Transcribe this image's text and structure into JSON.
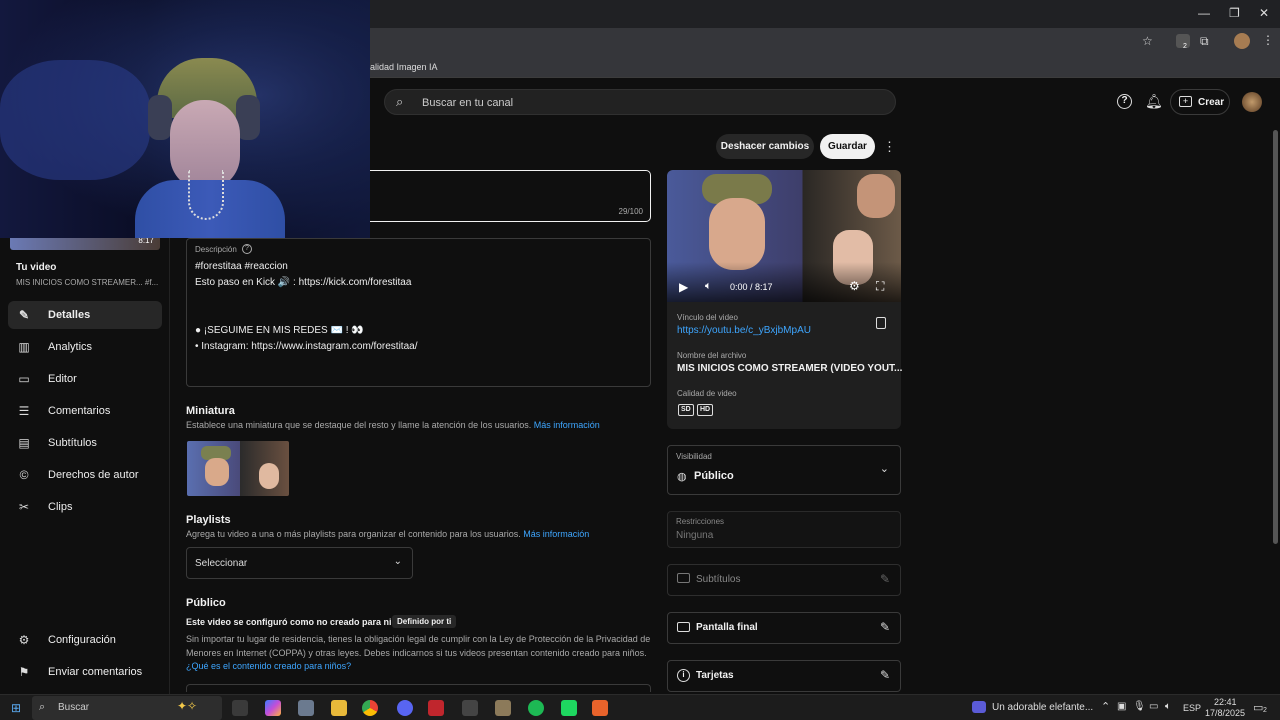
{
  "browser": {
    "bookmark_text": "alidad Imagen IA",
    "ext_badge": "2"
  },
  "header": {
    "search_placeholder": "Buscar en tu canal",
    "create_label": "Crear"
  },
  "sidebar": {
    "video_time": "8:17",
    "your_video_label": "Tu video",
    "video_title": "MIS INICIOS COMO STREAMER... #f...",
    "items": [
      {
        "label": "Detalles",
        "icon": "pencil-icon"
      },
      {
        "label": "Analytics",
        "icon": "analytics-icon"
      },
      {
        "label": "Editor",
        "icon": "editor-icon"
      },
      {
        "label": "Comentarios",
        "icon": "comments-icon"
      },
      {
        "label": "Subtítulos",
        "icon": "subtitles-icon"
      },
      {
        "label": "Derechos de autor",
        "icon": "copyright-icon"
      },
      {
        "label": "Clips",
        "icon": "scissors-icon"
      }
    ],
    "bottom": [
      {
        "label": "Configuración",
        "icon": "gear-icon"
      },
      {
        "label": "Enviar comentarios",
        "icon": "feedback-icon"
      }
    ]
  },
  "toolbar": {
    "undo_label": "Deshacer cambios",
    "save_label": "Guardar"
  },
  "title_field": {
    "counter": "29/100"
  },
  "description": {
    "label": "Descripción",
    "lines": [
      "#forestitaa #reaccion",
      "Esto paso en Kick 🔊 : https://kick.com/forestitaa",
      "",
      "",
      "● ¡SEGUIME EN MIS REDES ✉️ ! 👀",
      "• Instagram: https://www.instagram.com/forestitaa/"
    ]
  },
  "thumbnail": {
    "title": "Miniatura",
    "hint": "Establece una miniatura que se destaque del resto y llame la atención de los usuarios.",
    "link": "Más información"
  },
  "playlists": {
    "title": "Playlists",
    "hint": "Agrega tu video a una o más playlists para organizar el contenido para los usuarios.",
    "link": "Más información",
    "select_value": "Seleccionar"
  },
  "audience": {
    "title": "Público",
    "status": "Este video se configuró como no creado para niños",
    "badge": "Definido por ti",
    "legal": "Sin importar tu lugar de residencia, tienes la obligación legal de cumplir con la Ley de Protección de la Privacidad de Menores en Internet (COPPA) y otras leyes. Debes indicarnos si tus videos presentan contenido creado para niños.",
    "legal_link": "¿Qué es el contenido creado para niños?"
  },
  "player": {
    "time": "0:00 / 8:17",
    "link_label": "Vínculo del video",
    "link": "https://youtu.be/c_yBxjbMpAU",
    "file_label": "Nombre del archivo",
    "file_name": "MIS INICIOS COMO STREAMER (VIDEO YOUT...",
    "quality_label": "Calidad de video",
    "quality_badges": [
      "SD",
      "HD"
    ]
  },
  "visibility": {
    "label": "Visibilidad",
    "value": "Público"
  },
  "restrictions": {
    "label": "Restricciones",
    "value": "Ninguna"
  },
  "side_cards": [
    {
      "label": "Subtítulos",
      "icon": "subtitles-icon",
      "dim": true
    },
    {
      "label": "Pantalla final",
      "icon": "endscreen-icon",
      "dim": false
    },
    {
      "label": "Tarjetas",
      "icon": "info-icon",
      "dim": false
    }
  ],
  "taskbar": {
    "search": "Buscar",
    "news": "Un adorable elefante...",
    "lang": "ESP",
    "time": "22:41",
    "date": "17/8/2025",
    "notif": "2"
  },
  "colors": {
    "accent_link": "#3ea6ff",
    "bg": "#0f0f0f",
    "card": "#1f1f1f"
  }
}
